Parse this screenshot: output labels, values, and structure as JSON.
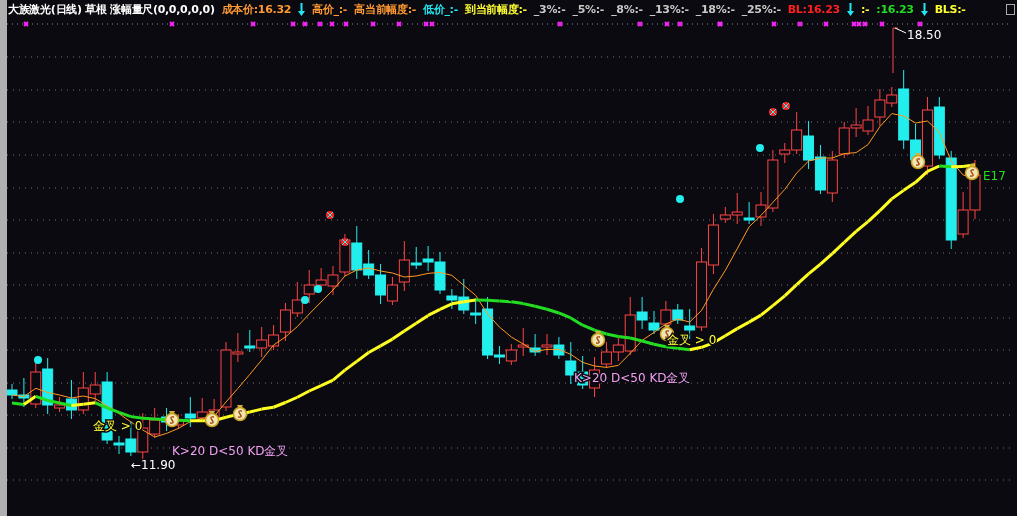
{
  "header": [
    {
      "text": "大族激光(日线) 草根 涨幅量尺(0,0,0,0,0)",
      "color": "#ffffff"
    },
    {
      "text": "成本价:16.32",
      "color": "#ff9933"
    },
    {
      "kind": "arrow",
      "color": "#22e6f0"
    },
    {
      "text": "高价_:-",
      "color": "#ff9933"
    },
    {
      "text": "高当前幅度:-",
      "color": "#ff9933"
    },
    {
      "text": "低价_:-",
      "color": "#22e6f0"
    },
    {
      "text": "到当前幅度:-",
      "color": "#ffff33"
    },
    {
      "text": "_3%:-",
      "color": "#c8c8c8"
    },
    {
      "text": "_5%:-",
      "color": "#c8c8c8"
    },
    {
      "text": "_8%:-",
      "color": "#c8c8c8"
    },
    {
      "text": "_13%:-",
      "color": "#c8c8c8"
    },
    {
      "text": "_18%:-",
      "color": "#c8c8c8"
    },
    {
      "text": "_25%:-",
      "color": "#c8c8c8"
    },
    {
      "text": "BL:16.23",
      "color": "#ff2020"
    },
    {
      "kind": "arrow",
      "color": "#22e6f0"
    },
    {
      "text": ":-",
      "color": "#ffff33"
    },
    {
      "text": ":16.23",
      "color": "#22dd22"
    },
    {
      "kind": "arrow",
      "color": "#22e6f0"
    },
    {
      "text": "BLS:-",
      "color": "#ffff33"
    }
  ],
  "annotations": [
    {
      "text": "18.50",
      "kind": "price"
    },
    {
      "text": "←11.90",
      "kind": "price"
    },
    {
      "text": "金叉 > 0",
      "kind": "cross"
    },
    {
      "text": "K>20 D<50 KD金叉",
      "kind": "kd"
    },
    {
      "text": "金叉 > 0",
      "kind": "cross"
    },
    {
      "text": "K>20 D<50 KD金叉",
      "kind": "kd"
    },
    {
      "text": "E17",
      "kind": "ma"
    }
  ]
}
